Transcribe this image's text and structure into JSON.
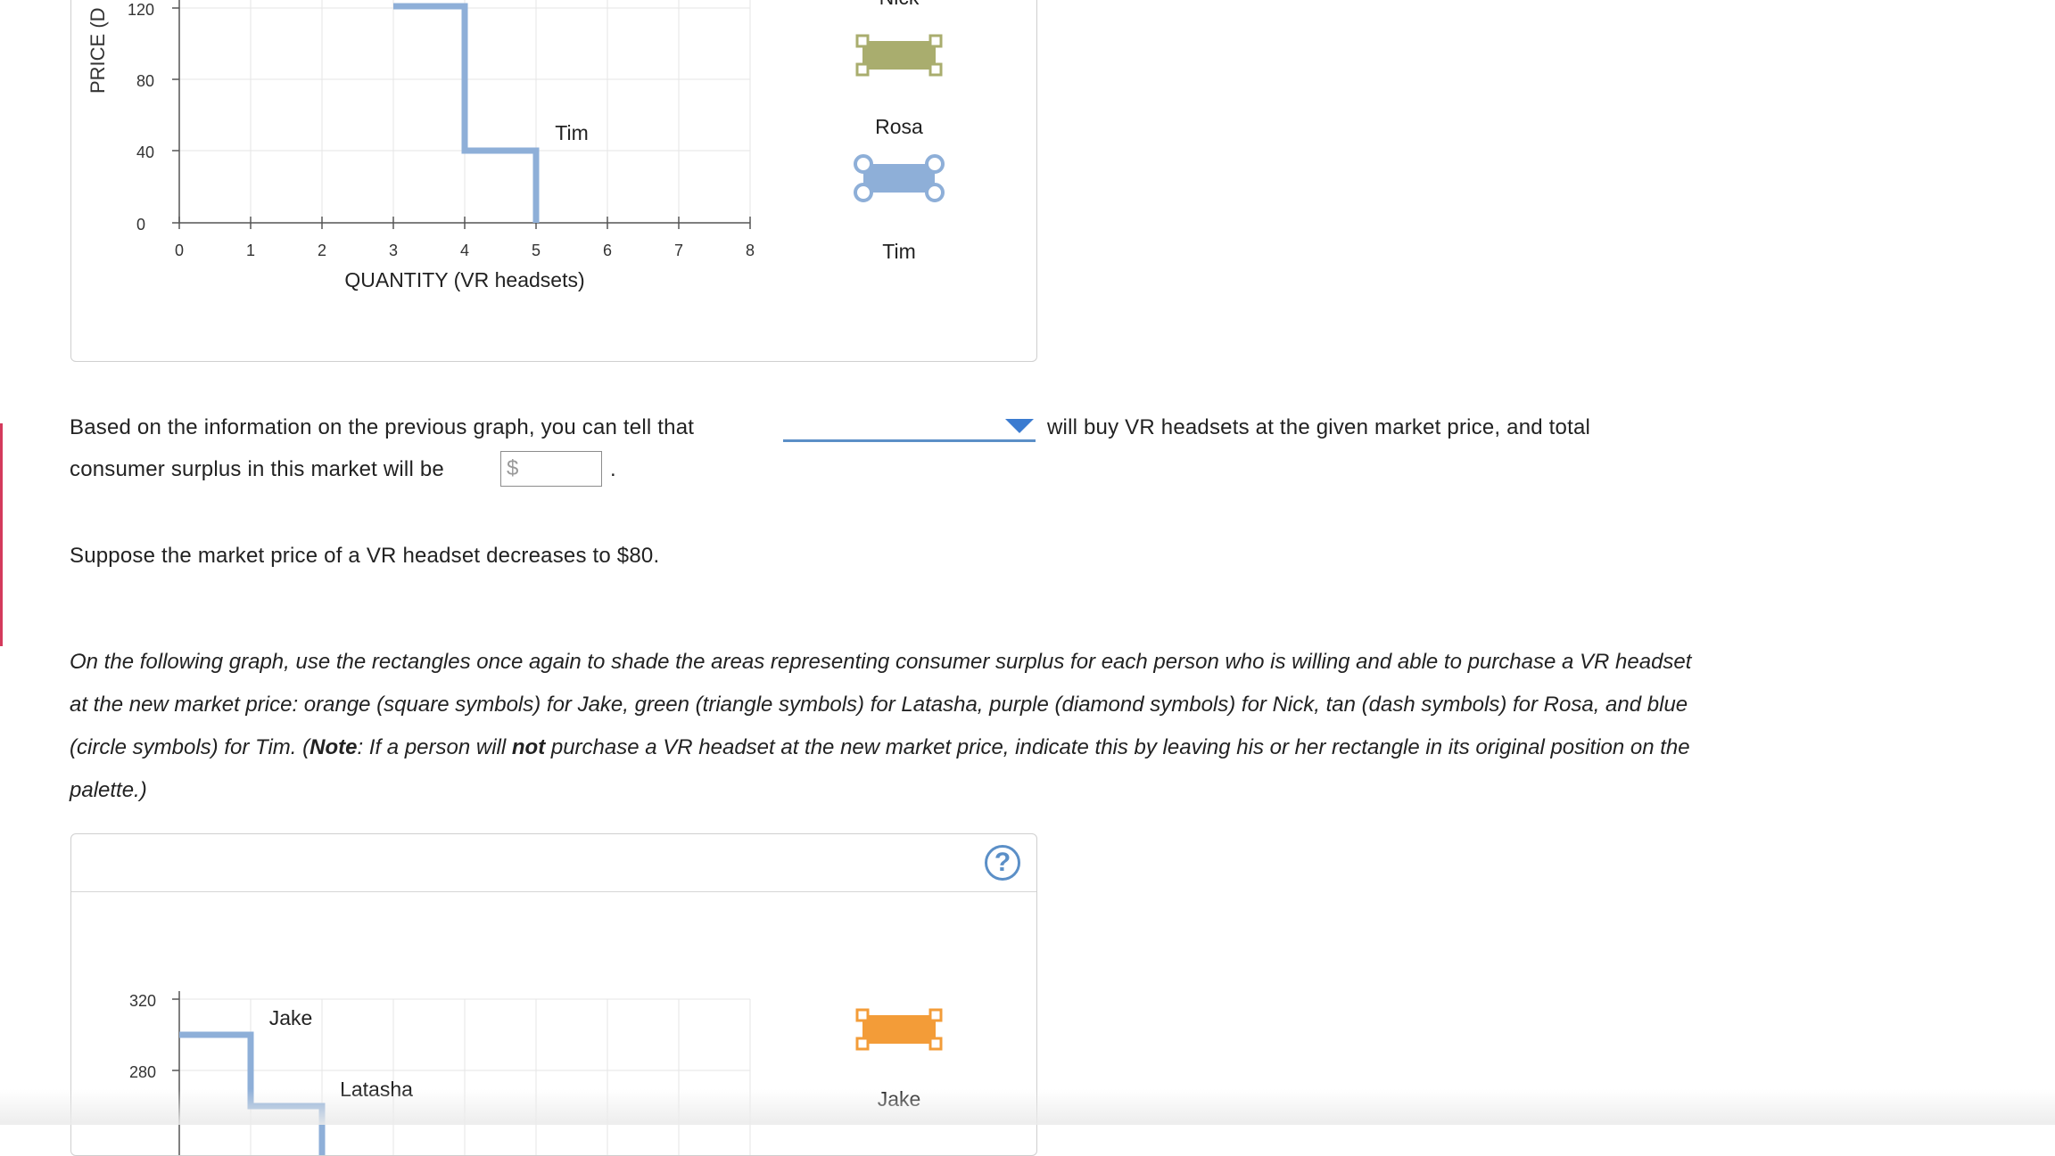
{
  "graph1": {
    "y_axis_title": "PRICE (D",
    "y_ticks": [
      "120",
      "80",
      "40",
      "0"
    ],
    "x_ticks": [
      "0",
      "1",
      "2",
      "3",
      "4",
      "5",
      "6",
      "7",
      "8"
    ],
    "x_axis_title": "QUANTITY (VR headsets)",
    "curve_label": "Tim",
    "palette_labels": [
      "Nick",
      "Rosa",
      "Tim"
    ]
  },
  "question": {
    "sentence_part1": "Based on the information on the previous graph, you can tell that",
    "sentence_part2": "will buy VR headsets at the given market price, and total",
    "sentence_part3": "consumer surplus in this market will be",
    "input_prefix": "$",
    "sentence_end": ".",
    "dropdown_value": ""
  },
  "price_change": "Suppose the market price of a VR headset decreases to $80.",
  "instructions": {
    "lead": "On the following graph, use the rectangles once again to shade the areas representing consumer surplus for each person who is willing and able to purchase a VR headset at the new market price: orange (square symbols) for Jake, green (triangle symbols) for Latasha, purple (diamond symbols) for Nick, tan (dash symbols) for Rosa, and blue (circle symbols) for Tim. (",
    "note_label": "Note",
    "note_mid": ": If a person will ",
    "not_word": "not",
    "note_end": " purchase a VR headset at the new market price, indicate this by leaving his or her rectangle in its original position on the palette.)"
  },
  "graph2": {
    "help_label": "?",
    "y_ticks": [
      "320",
      "280"
    ],
    "labels": [
      "Jake",
      "Latasha"
    ],
    "palette_labels": [
      "Jake"
    ]
  },
  "colors": {
    "curve": "#8eafd8",
    "nick_rect": "#a9ad6e",
    "tim_rect": "#8eafd8",
    "jake_rect": "#f39c38",
    "accent": "#3b7bd0"
  }
}
